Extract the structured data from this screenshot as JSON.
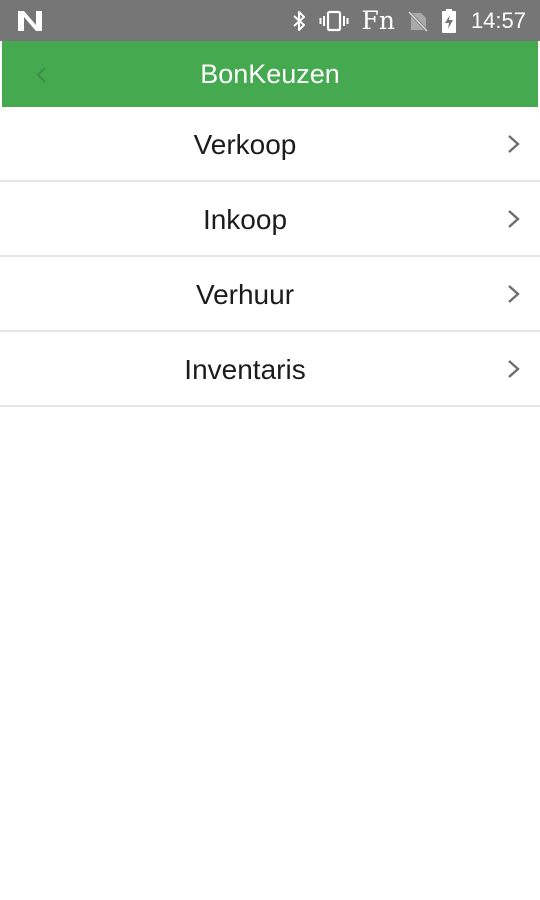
{
  "status_bar": {
    "left_icon": "n-notification-icon",
    "icons": [
      "bluetooth-icon",
      "vibrate-icon",
      "no-sim-icon",
      "battery-charging-icon"
    ],
    "fn_label": "Fn",
    "time": "14:57"
  },
  "app_bar": {
    "back_icon": "back-arrow-icon",
    "title": "BonKeuzen",
    "background": "#45a94f"
  },
  "menu": {
    "items": [
      {
        "label": "Verkoop"
      },
      {
        "label": "Inkoop"
      },
      {
        "label": "Verhuur"
      },
      {
        "label": "Inventaris"
      }
    ],
    "chevron_icon": "chevron-right-icon"
  }
}
